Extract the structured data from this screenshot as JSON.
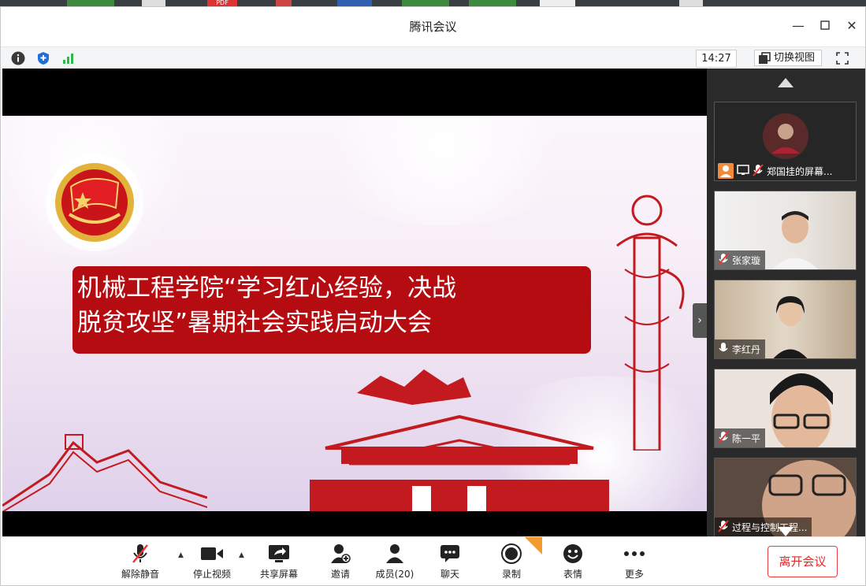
{
  "window": {
    "title": "腾讯会议"
  },
  "taskstrip": {
    "pdf_label": "PDF"
  },
  "toolbar": {
    "time": "14:27",
    "switch_view": "切换视图"
  },
  "slide": {
    "title_line1": "机械工程学院“学习红心经验，决战",
    "title_line2": "脱贫攻坚”暑期社会实践启动大会"
  },
  "participants": [
    {
      "name": "郑国挂的屏幕...",
      "muted": true,
      "sharing": true
    },
    {
      "name": "张家璇",
      "muted": true
    },
    {
      "name": "李红丹",
      "muted": false
    },
    {
      "name": "陈一平",
      "muted": true
    },
    {
      "name": "过程与控制工程...",
      "muted": true
    }
  ],
  "bottombar": {
    "unmute": "解除静音",
    "stop_video": "停止视频",
    "share_screen": "共享屏幕",
    "invite": "邀请",
    "members": "成员(20)",
    "chat": "聊天",
    "record": "录制",
    "emoji": "表情",
    "more": "更多",
    "leave": "离开会议"
  },
  "colors": {
    "accent_red": "#b50c12",
    "leave_red": "#e02b2b",
    "green": "#2eb84c",
    "blue": "#1e6fdc"
  }
}
